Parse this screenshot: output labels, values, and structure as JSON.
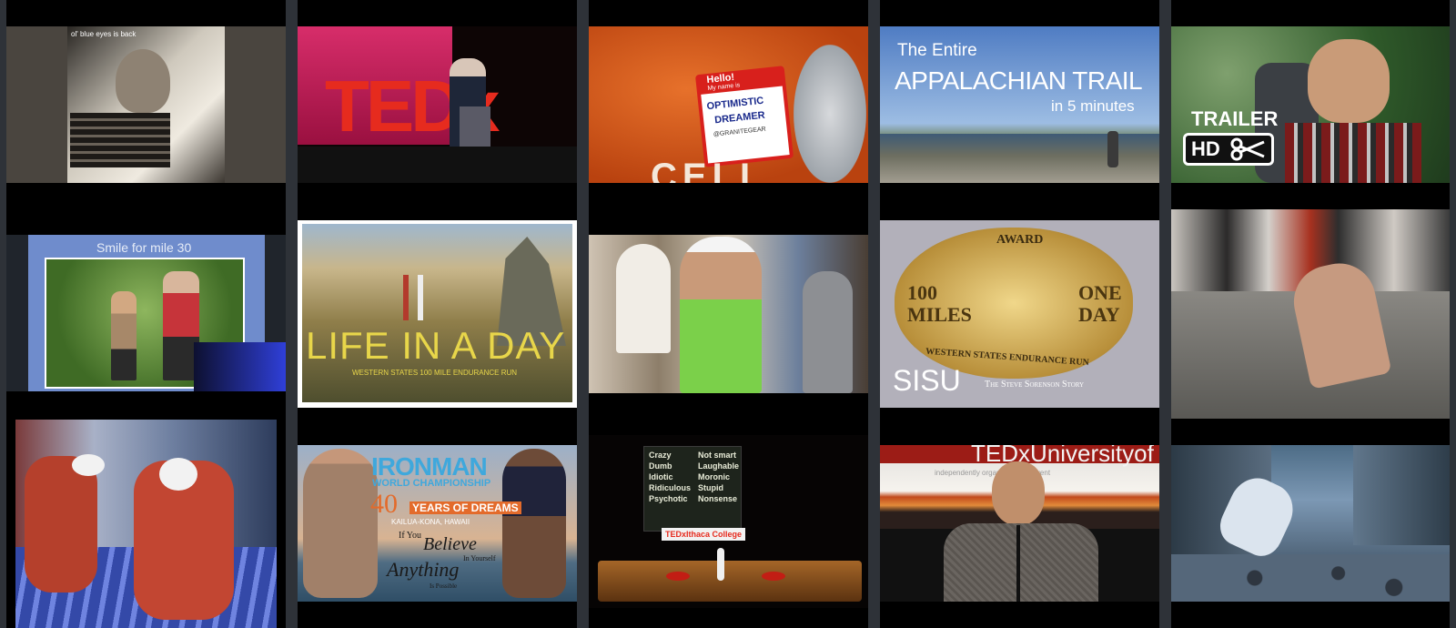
{
  "gallery": {
    "title": "Video thumbnail gallery",
    "thumbnails": [
      {
        "id": "t1",
        "caption": "ol' blue eyes is back"
      },
      {
        "id": "t2",
        "caption": "TEDx"
      },
      {
        "id": "t3",
        "badge_hello": "Hello!",
        "badge_name": "My name is",
        "badge_text_1": "OPTIMISTIC",
        "badge_text_2": "DREAMER",
        "badge_handle": "@GRANITEGEAR",
        "shirt_text": "CELL"
      },
      {
        "id": "t4",
        "line1": "The Entire",
        "line2": "APPALACHIAN TRAIL",
        "line3": "in 5 minutes"
      },
      {
        "id": "t5",
        "trailer": "TRAILER",
        "hd": "HD"
      },
      {
        "id": "t6",
        "caption": "Smile for mile 30"
      },
      {
        "id": "t7",
        "title": "LIFE IN A DAY",
        "subtitle": "WESTERN STATES 100 MILE ENDURANCE RUN"
      },
      {
        "id": "t8"
      },
      {
        "id": "t9",
        "award": "AWARD",
        "left": "100 MILES",
        "right": "ONE DAY",
        "rim": "WESTERN STATES ENDURANCE RUN",
        "title": "SISU",
        "subtitle": "The Steve Sorenson Story"
      },
      {
        "id": "t10"
      },
      {
        "id": "t11"
      },
      {
        "id": "t12",
        "brand": "IRONMAN",
        "world": "WORLD CHAMPIONSHIP",
        "years_num": "40",
        "years_text": "YEARS OF DREAMS",
        "place": "KAILUA-KONA, HAWAII",
        "if_you": "If You",
        "believe": "Believe",
        "in_yourself": "In Yourself",
        "anything": "Anything",
        "is_possible": "Is Possible"
      },
      {
        "id": "t13",
        "left_words": [
          "Crazy",
          "Dumb",
          "Idiotic",
          "Ridiculous",
          "Psychotic"
        ],
        "right_words": [
          "Not smart",
          "Laughable",
          "Moronic",
          "Stupid",
          "Nonsense"
        ],
        "banner": "TEDxIthaca College"
      },
      {
        "id": "t14",
        "sign": "TEDxUniversityof",
        "sign_sub": "independently organized TED event"
      },
      {
        "id": "t15"
      }
    ]
  },
  "colors": {
    "column_bg": "#000000",
    "gutter": "#2e3238",
    "ted_red": "#e62b1e",
    "gold": "#c9a23f"
  }
}
